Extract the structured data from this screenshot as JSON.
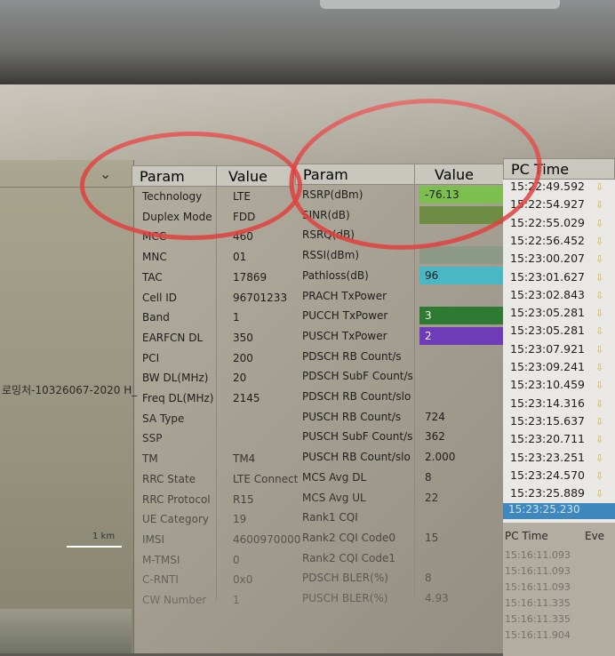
{
  "map": {
    "label": "로밍처-10326067-2020 H_",
    "scale": "1 km"
  },
  "table1": {
    "header": {
      "param": "Param",
      "value": "Value"
    },
    "rows": [
      {
        "param": "Technology",
        "value": "LTE"
      },
      {
        "param": "Duplex Mode",
        "value": "FDD"
      },
      {
        "param": "MCC",
        "value": "460"
      },
      {
        "param": "MNC",
        "value": "01"
      },
      {
        "param": "TAC",
        "value": "17869"
      },
      {
        "param": "Cell ID",
        "value": "96701233"
      },
      {
        "param": "Band",
        "value": "1"
      },
      {
        "param": "EARFCN DL",
        "value": "350"
      },
      {
        "param": "PCI",
        "value": "200"
      },
      {
        "param": "BW DL(MHz)",
        "value": "20"
      },
      {
        "param": "Freq DL(MHz)",
        "value": "2145"
      },
      {
        "param": "SA Type",
        "value": ""
      },
      {
        "param": "SSP",
        "value": ""
      },
      {
        "param": "TM",
        "value": "TM4"
      },
      {
        "param": "RRC State",
        "value": "LTE Connect"
      },
      {
        "param": "RRC Protocol",
        "value": "R15"
      },
      {
        "param": "UE Category",
        "value": "19"
      },
      {
        "param": "IMSI",
        "value": "4600970000"
      },
      {
        "param": "M-TMSI",
        "value": "0"
      },
      {
        "param": "C-RNTI",
        "value": "0x0"
      },
      {
        "param": "CW Number",
        "value": "1"
      }
    ]
  },
  "table2": {
    "header": {
      "param": "Param",
      "value": "Value"
    },
    "rows": [
      {
        "param": "RSRP(dBm)",
        "value": "-76.13",
        "color": "#7dbf4e"
      },
      {
        "param": "SINR(dB)",
        "value": "",
        "color": "#6d8d45"
      },
      {
        "param": "RSRQ(dB)",
        "value": "",
        "color": ""
      },
      {
        "param": "RSSI(dBm)",
        "value": "",
        "color": "#8c9a86"
      },
      {
        "param": "Pathloss(dB)",
        "value": "96",
        "color": "#4ab7c4"
      },
      {
        "param": "PRACH TxPower",
        "value": "",
        "color": ""
      },
      {
        "param": "PUCCH TxPower",
        "value": "3",
        "color": "#2e7a32"
      },
      {
        "param": "PUSCH TxPower",
        "value": "2",
        "color": "#6f3cb8"
      },
      {
        "param": "PDSCH RB Count/s",
        "value": "",
        "color": ""
      },
      {
        "param": "PDSCH SubF Count/s",
        "value": "",
        "color": ""
      },
      {
        "param": "PDSCH RB Count/slo",
        "value": "",
        "color": ""
      },
      {
        "param": "PUSCH RB Count/s",
        "value": "724",
        "color": ""
      },
      {
        "param": "PUSCH SubF Count/s",
        "value": "362",
        "color": ""
      },
      {
        "param": "PUSCH RB Count/slo",
        "value": "2.000",
        "color": ""
      },
      {
        "param": "MCS Avg DL",
        "value": "8",
        "color": ""
      },
      {
        "param": "MCS Avg UL",
        "value": "22",
        "color": ""
      },
      {
        "param": "Rank1 CQI",
        "value": "",
        "color": ""
      },
      {
        "param": "Rank2 CQI Code0",
        "value": "15",
        "color": ""
      },
      {
        "param": "Rank2 CQI Code1",
        "value": "",
        "color": ""
      },
      {
        "param": "PDSCH BLER(%)",
        "value": "8",
        "color": ""
      },
      {
        "param": "PUSCH BLER(%)",
        "value": "4.93",
        "color": ""
      }
    ]
  },
  "time": {
    "header": "PC Time",
    "rows": [
      "15:22:49.592",
      "15:22:54.927",
      "15:22:55.029",
      "15:22:56.452",
      "15:23:00.207",
      "15:23:01.627",
      "15:23:02.843",
      "15:23:05.281",
      "15:23:05.281",
      "15:23:07.921",
      "15:23:09.241",
      "15:23:10.459",
      "15:23:14.316",
      "15:23:15.637",
      "15:23:20.711",
      "15:23:23.251",
      "15:23:24.570",
      "15:23:25.889"
    ],
    "selected": "15:23:25.230",
    "lower_header": "PC Time",
    "lower_header2": "Eve",
    "lower_rows": [
      "15:16:11.093",
      "15:16:11.093",
      "15:16:11.093",
      "15:16:11.335",
      "15:16:11.335",
      "15:16:11.904"
    ]
  },
  "colors": {
    "annotation": "#e0403e",
    "selection": "#3e88bd"
  }
}
